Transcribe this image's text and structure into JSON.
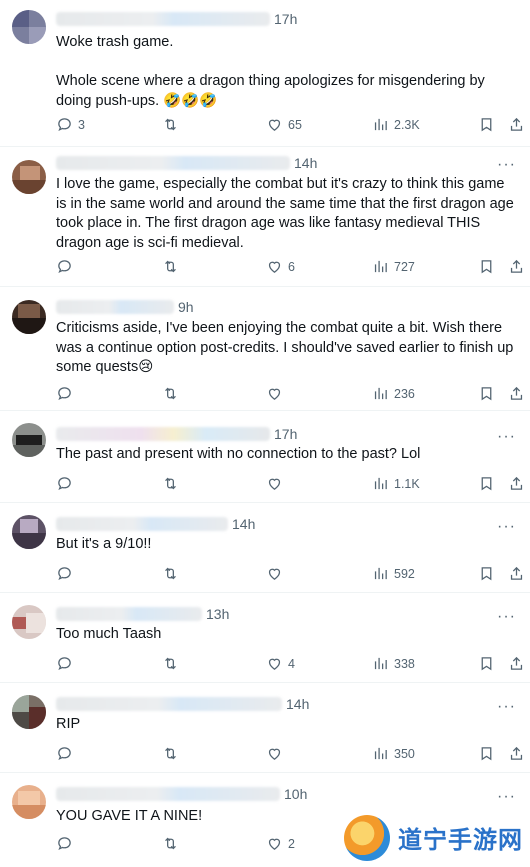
{
  "tweets": [
    {
      "time": "17h",
      "text": "Woke trash game.\n\nWhole scene where a dragon thing apologizes for misgendering by doing push-ups. 🤣🤣🤣",
      "replies": "3",
      "retweets": "",
      "likes": "65",
      "views": "2.3K"
    },
    {
      "time": "14h",
      "text": "I love the game, especially the combat but it's crazy to think this game is in the same world and around the same time that the first dragon age took place in. The first dragon age was like fantasy medieval THIS dragon age is sci-fi medieval.",
      "replies": "",
      "retweets": "",
      "likes": "6",
      "views": "727"
    },
    {
      "time": "9h",
      "text": "Criticisms aside, I've been enjoying the combat quite a bit. Wish there was a continue option post-credits. I should've saved earlier to finish up some quests😢",
      "replies": "",
      "retweets": "",
      "likes": "",
      "views": "236"
    },
    {
      "time": "17h",
      "text": "The past and present with no connection to the past? Lol",
      "replies": "",
      "retweets": "",
      "likes": "",
      "views": "1.1K"
    },
    {
      "time": "14h",
      "text": "But it's a 9/10!!",
      "replies": "",
      "retweets": "",
      "likes": "",
      "views": "592"
    },
    {
      "time": "13h",
      "text": "Too much Taash",
      "replies": "",
      "retweets": "",
      "likes": "4",
      "views": "338"
    },
    {
      "time": "14h",
      "text": "RIP",
      "replies": "",
      "retweets": "",
      "likes": "",
      "views": "350"
    },
    {
      "time": "10h",
      "text": "YOU GAVE IT A NINE!",
      "replies": "",
      "retweets": "",
      "likes": "2",
      "views": ""
    }
  ],
  "more_glyph": "···",
  "watermark": {
    "text": "道宁手游网"
  },
  "colors": {
    "text": "#0f1419",
    "muted": "#536471",
    "divider": "#eff3f4",
    "accent": "#1d9bf0"
  }
}
